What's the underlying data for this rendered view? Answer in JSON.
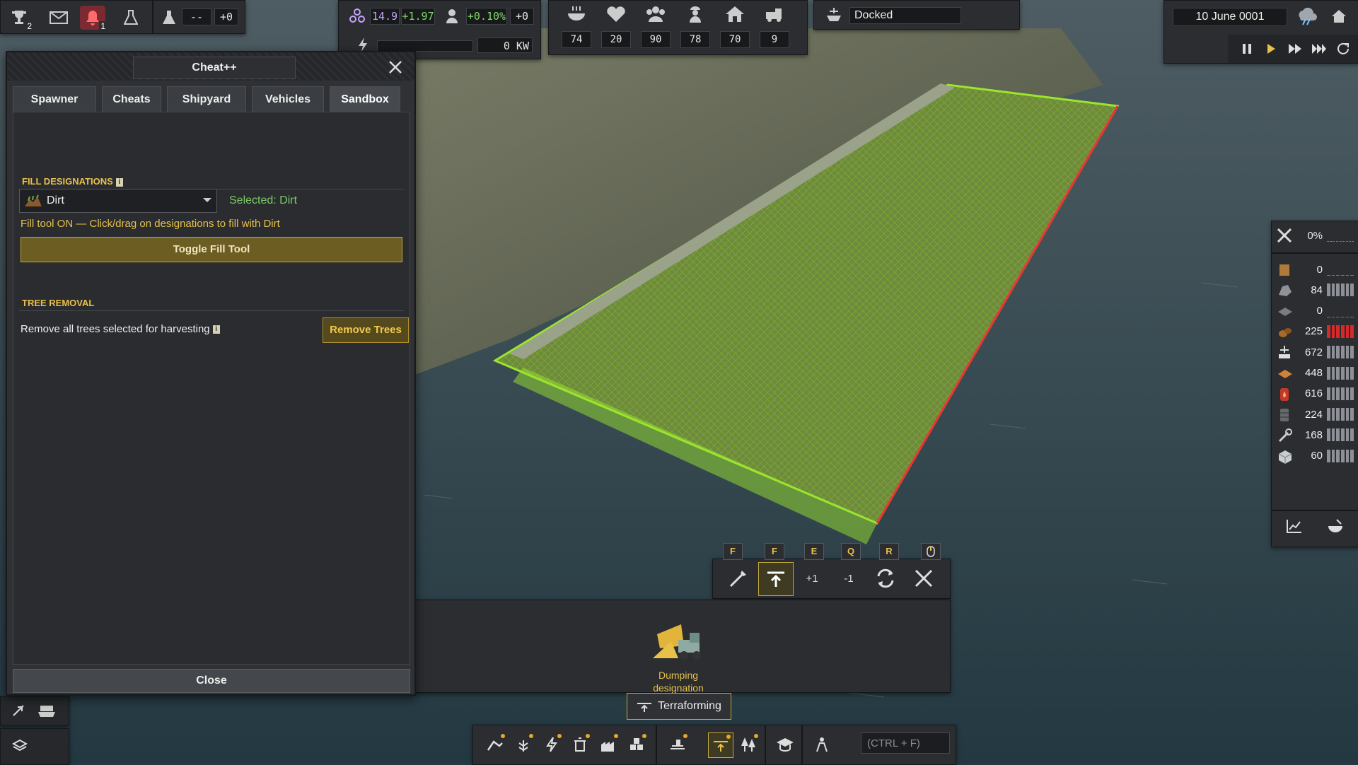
{
  "top_left": {
    "trophy_count": "2",
    "alert_count": "1",
    "research_value": "--",
    "research_delta": "+0"
  },
  "stats": {
    "unity": "14.9",
    "unity_delta": "+1.97",
    "pop_growth": "+0.10%",
    "pop_delta": "+0",
    "power": "0 KW"
  },
  "status_icons": [
    {
      "icon": "food-icon",
      "value": "74"
    },
    {
      "icon": "health-icon",
      "value": "20"
    },
    {
      "icon": "population-icon",
      "value": "90"
    },
    {
      "icon": "workers-icon",
      "value": "78"
    },
    {
      "icon": "housing-icon",
      "value": "70"
    },
    {
      "icon": "vehicles-icon",
      "value": "9"
    }
  ],
  "ship_status": "Docked",
  "date": "10 June 0001",
  "resources": {
    "maintenance_pct": "0%",
    "items": [
      {
        "icon": "wood-icon",
        "value": "0"
      },
      {
        "icon": "rock-icon",
        "value": "84"
      },
      {
        "icon": "plate-icon",
        "value": "0"
      },
      {
        "icon": "ore-icon",
        "value": "225"
      },
      {
        "icon": "crane-icon",
        "value": "672"
      },
      {
        "icon": "slab-icon",
        "value": "448"
      },
      {
        "icon": "fuel-icon",
        "value": "616"
      },
      {
        "icon": "barrel-icon",
        "value": "224"
      },
      {
        "icon": "tool-icon",
        "value": "168"
      },
      {
        "icon": "box-icon",
        "value": "60"
      }
    ]
  },
  "cheat_window": {
    "title": "Cheat++",
    "tabs": [
      "Spawner",
      "Cheats",
      "Shipyard",
      "Vehicles",
      "Sandbox"
    ],
    "active_tab": "Sandbox",
    "fill": {
      "header": "FILL DESIGNATIONS",
      "material": "Dirt",
      "selected": "Selected: Dirt",
      "status": "Fill tool ON — Click/drag on designations to fill with Dirt",
      "toggle_label": "Toggle Fill Tool"
    },
    "trees": {
      "header": "TREE REMOVAL",
      "description": "Remove all trees selected for harvesting",
      "button": "Remove Trees"
    },
    "close_label": "Close"
  },
  "terraform": {
    "keys": [
      "F",
      "F",
      "E",
      "Q",
      "R"
    ],
    "plus_label": "+1",
    "minus_label": "-1",
    "dumping_label": "Dumping designation",
    "category_label": "Terraforming"
  },
  "search_placeholder": "(CTRL + F)",
  "colors": {
    "accent_yellow": "#e7c14a",
    "positive_green": "#7ec96a",
    "panel_bg": "#2f3134",
    "alert_red": "#d62a2a"
  }
}
